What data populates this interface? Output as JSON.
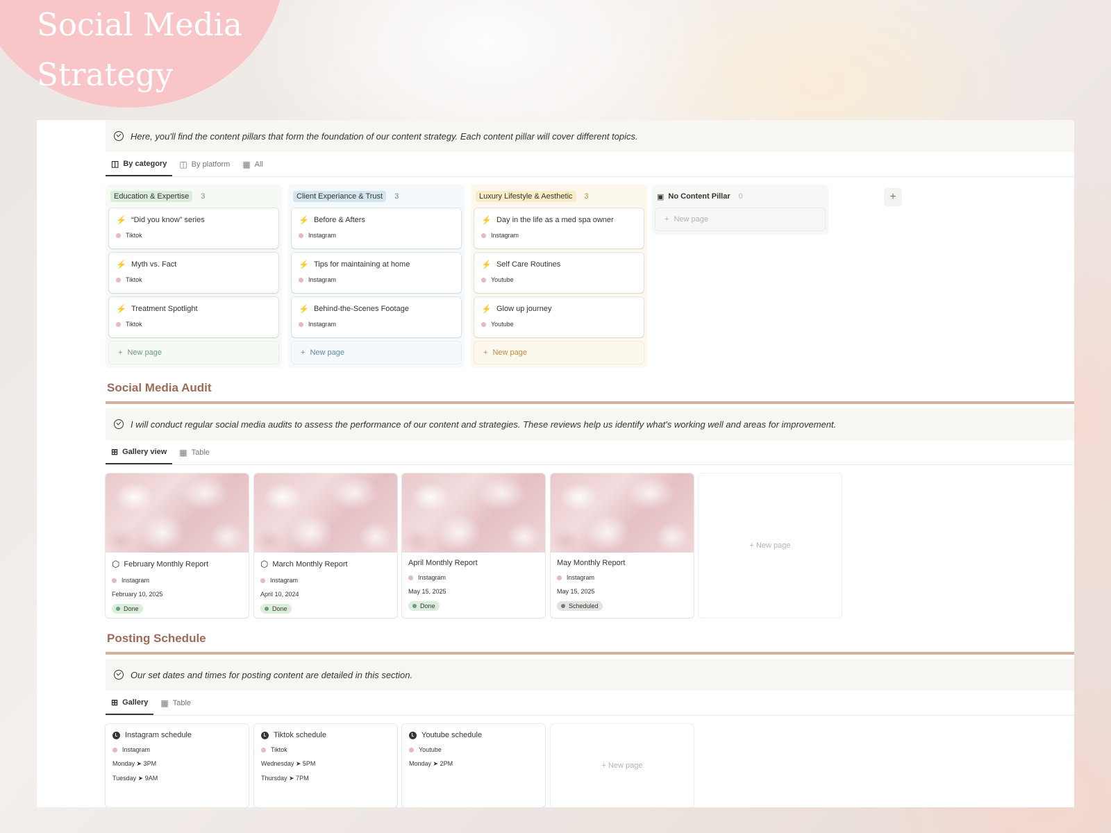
{
  "hero": {
    "title_line1": "Social Media",
    "title_line2": "Strategy"
  },
  "pillars": {
    "callout": "Here, you'll find the content pillars that form the foundation of our content strategy. Each content pillar will cover different topics.",
    "tabs": [
      {
        "label": "By category",
        "icon": "board-icon",
        "active": true
      },
      {
        "label": "By platform",
        "icon": "board-icon",
        "active": false
      },
      {
        "label": "All",
        "icon": "table-icon",
        "active": false
      }
    ],
    "columns": [
      {
        "label": "Education & Expertise",
        "count": "3",
        "tag_color": "#dbeddb",
        "bg_color": "#f6faf5",
        "count_color": "#6c9b7d",
        "cards": [
          {
            "title": "“Did you know” series",
            "platform": "Tiktok"
          },
          {
            "title": "Myth vs. Fact",
            "platform": "Tiktok"
          },
          {
            "title": "Treatment Spotlight",
            "platform": "Tiktok"
          }
        ],
        "new_page": "New page"
      },
      {
        "label": "Client Experiance & Trust",
        "count": "3",
        "tag_color": "#d3e5ef",
        "bg_color": "#f5f9fc",
        "count_color": "#5b8aab",
        "cards": [
          {
            "title": "Before & Afters",
            "platform": "Instagram"
          },
          {
            "title": "Tips for maintaining at home",
            "platform": "Instagram"
          },
          {
            "title": "Behind-the-Scenes Footage",
            "platform": "Instagram"
          }
        ],
        "new_page": "New page"
      },
      {
        "label": "Luxury Lifestyle & Aesthetic",
        "count": "3",
        "tag_color": "#fbecc8",
        "bg_color": "#fdf8ee",
        "count_color": "#c48a3a",
        "cards": [
          {
            "title": "Day in the life as a med spa owner",
            "platform": "Instagram"
          },
          {
            "title": "Self Care Routines",
            "platform": "Youtube"
          },
          {
            "title": "Glow up journey",
            "platform": "Youtube"
          }
        ],
        "new_page": "New page"
      },
      {
        "label": "No Content Pillar",
        "count": "0",
        "tag_color": "transparent",
        "bg_color": "#f7f7f5",
        "count_color": "#b4b4b0",
        "cards": [],
        "new_page": "New page"
      }
    ],
    "add_group": "+"
  },
  "audit": {
    "title": "Social Media Audit",
    "callout": "I will conduct regular social media audits to assess the performance of our content and strategies. These reviews help us identify what's working well and areas for improvement.",
    "tabs": [
      {
        "label": "Gallery view",
        "icon": "gallery-icon",
        "active": true
      },
      {
        "label": "Table",
        "icon": "table-icon",
        "active": false
      }
    ],
    "cards": [
      {
        "title": "February Monthly Report",
        "icon": true,
        "platform": "Instagram",
        "date": "February 10, 2025",
        "status": "Done"
      },
      {
        "title": "March Monthly Report",
        "icon": true,
        "platform": "Instagram",
        "date": "April 10, 2024",
        "status": "Done"
      },
      {
        "title": "April Monthly Report",
        "icon": false,
        "platform": "Instagram",
        "date": "May 15, 2025",
        "status": "Done"
      },
      {
        "title": "May Monthly Report",
        "icon": false,
        "platform": "Instagram",
        "date": "May 15, 2025",
        "status": "Scheduled"
      }
    ],
    "new_page": "New page",
    "status_colors": {
      "Done": {
        "bg": "#dbeddb",
        "dot": "#6c9b7d"
      },
      "Scheduled": {
        "bg": "#e3e2e0",
        "dot": "#787774"
      }
    }
  },
  "schedule": {
    "title": "Posting Schedule",
    "callout": "Our set dates and times for posting content are detailed in this section.",
    "tabs": [
      {
        "label": "Gallery",
        "icon": "gallery-icon",
        "active": true
      },
      {
        "label": "Table",
        "icon": "table-icon",
        "active": false
      }
    ],
    "cards": [
      {
        "title": "Instagram schedule",
        "platform": "Instagram",
        "times": [
          "Monday ➤ 3PM",
          "Tuesday ➤ 9AM"
        ]
      },
      {
        "title": "Tiktok schedule",
        "platform": "Tiktok",
        "times": [
          "Wednesday ➤ 5PM",
          "Thursday ➤ 7PM"
        ]
      },
      {
        "title": "Youtube schedule",
        "platform": "Youtube",
        "times": [
          "Monday ➤ 2PM"
        ]
      }
    ],
    "new_page": "New page"
  }
}
